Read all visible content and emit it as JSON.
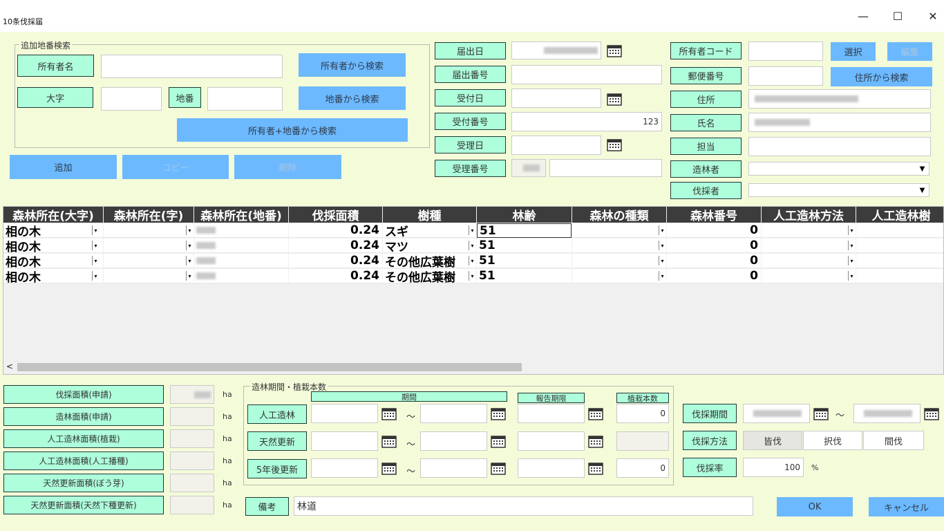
{
  "window": {
    "title": "10条伐採届",
    "minimize": "—",
    "maximize": "☐",
    "close": "✕"
  },
  "search": {
    "group_title": "追加地番検索",
    "owner_name_label": "所有者名",
    "owner_name_value": "",
    "oaza_label": "大字",
    "oaza_value": "",
    "chiban_label": "地番",
    "chiban_value": "",
    "search_owner": "所有者から検索",
    "search_chiban": "地番から検索",
    "search_owner_chiban": "所有者+地番から検索"
  },
  "actions": {
    "add": "追加",
    "copy": "コピー",
    "delete": "削除"
  },
  "notice": {
    "todokede_date_label": "届出日",
    "todokede_no_label": "届出番号",
    "uketsuke_date_label": "受付日",
    "uketsuke_no_label": "受付番号",
    "uketsuke_no_value": "123",
    "juri_date_label": "受理日",
    "juri_no_label": "受理番号"
  },
  "owner": {
    "code_label": "所有者コード",
    "select": "選択",
    "edit": "編集",
    "postal_label": "郵便番号",
    "search_address": "住所から検索",
    "address_label": "住所",
    "name_label": "氏名",
    "tanto_label": "担当",
    "zorin_label": "造林者",
    "bassai_label": "伐採者"
  },
  "grid": {
    "columns": [
      "森林所在(大字)",
      "森林所在(字)",
      "森林所在(地番)",
      "伐採面積",
      "樹種",
      "林齢",
      "森林の種類",
      "森林番号",
      "人工造林方法",
      "人工造林樹"
    ],
    "rows": [
      {
        "oaza": "相の木",
        "aza": "",
        "area": "0.24",
        "species": "スギ",
        "age": "51",
        "kind": "",
        "forest_no": "0"
      },
      {
        "oaza": "相の木",
        "aza": "",
        "area": "0.24",
        "species": "マツ",
        "age": "51",
        "kind": "",
        "forest_no": "0"
      },
      {
        "oaza": "相の木",
        "aza": "",
        "area": "0.24",
        "species": "その他広葉樹",
        "age": "51",
        "kind": "",
        "forest_no": "0"
      },
      {
        "oaza": "相の木",
        "aza": "",
        "area": "0.24",
        "species": "その他広葉樹",
        "age": "51",
        "kind": "",
        "forest_no": "0"
      }
    ],
    "scroll_left": "<"
  },
  "areas": {
    "labels": [
      "伐採面積(申請)",
      "造林面積(申請)",
      "人工造林面積(植栽)",
      "人工造林面積(人工播種)",
      "天然更新面積(ぼう芽)",
      "天然更新面積(天然下種更新)"
    ],
    "unit": "ha"
  },
  "period_group": {
    "title": "造林期間・植栽本数",
    "col_period": "期間",
    "col_report": "報告期限",
    "col_count": "植栽本数",
    "rows": [
      {
        "label": "人工造林",
        "count": "0"
      },
      {
        "label": "天然更新",
        "count": ""
      },
      {
        "label": "5年後更新",
        "count": "0"
      }
    ],
    "tilde": "～"
  },
  "cutting": {
    "period_label": "伐採期間",
    "tilde": "～",
    "method_label": "伐採方法",
    "methods": [
      "皆伐",
      "択伐",
      "間伐"
    ],
    "rate_label": "伐採率",
    "rate_value": "100",
    "rate_unit": "%"
  },
  "remarks": {
    "label": "備考",
    "value": "林道"
  },
  "footer": {
    "ok": "OK",
    "cancel": "キャンセル"
  }
}
